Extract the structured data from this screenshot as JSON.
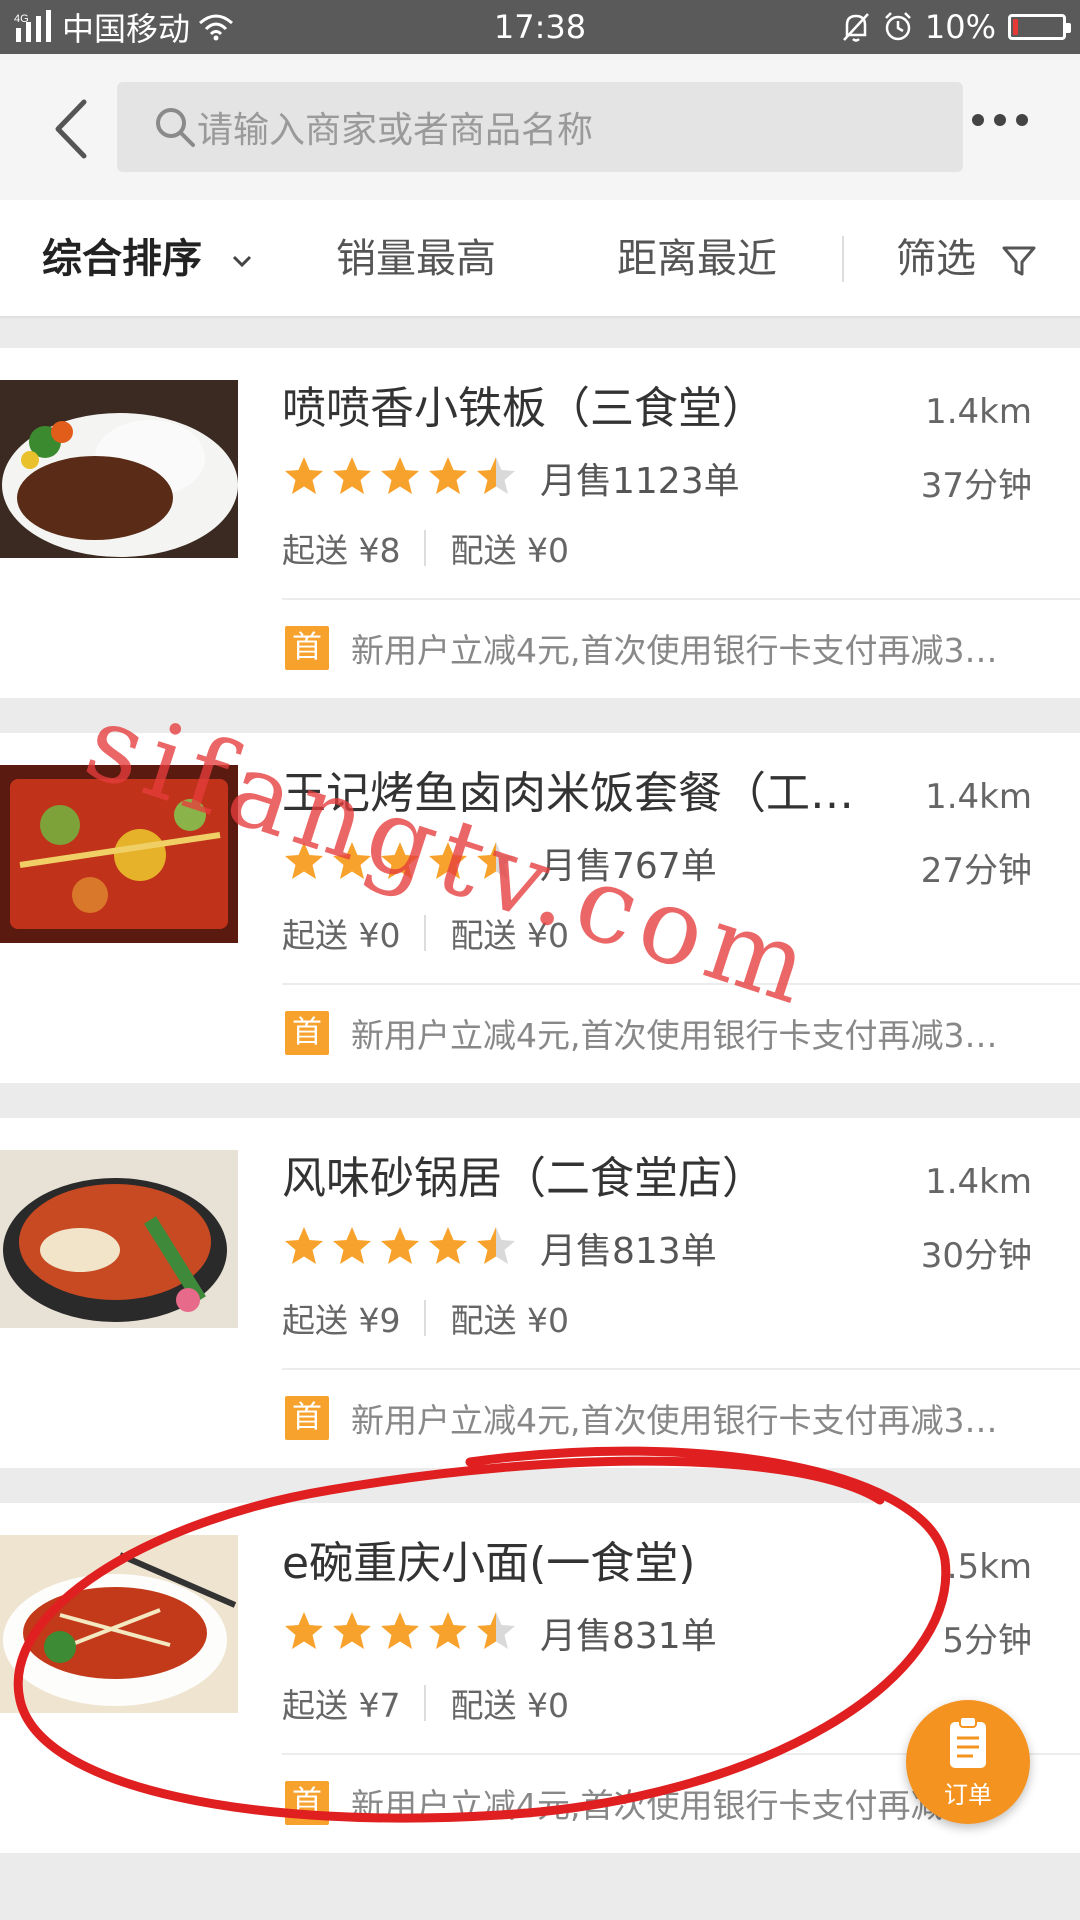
{
  "status_bar": {
    "network": "4G",
    "carrier": "中国移动",
    "time": "17:38",
    "battery": "10%",
    "battery_level": 0.1
  },
  "header": {
    "search_placeholder": "请输入商家或者商品名称"
  },
  "sort_bar": {
    "items": [
      "综合排序",
      "销量最高",
      "距离最近",
      "筛选"
    ]
  },
  "shops": [
    {
      "name": "喷喷香小铁板（三食堂）",
      "distance": "1.4km",
      "time": "37分钟",
      "rating": 4.5,
      "sales": "月售1123单",
      "min_order": "起送 ¥8",
      "delivery_fee": "配送 ¥0",
      "promo_badge": "首",
      "promo_text": "新用户立减4元,首次使用银行卡支付再减3…"
    },
    {
      "name": "王记烤鱼卤肉米饭套餐（工…",
      "distance": "1.4km",
      "time": "27分钟",
      "rating": 4.5,
      "sales": "月售767单",
      "min_order": "起送 ¥0",
      "delivery_fee": "配送 ¥0",
      "promo_badge": "首",
      "promo_text": "新用户立减4元,首次使用银行卡支付再减3…"
    },
    {
      "name": "风味砂锅居（二食堂店）",
      "distance": "1.4km",
      "time": "30分钟",
      "rating": 4.5,
      "sales": "月售813单",
      "min_order": "起送 ¥9",
      "delivery_fee": "配送 ¥0",
      "promo_badge": "首",
      "promo_text": "新用户立减4元,首次使用银行卡支付再减3…"
    },
    {
      "name": "e碗重庆小面(一食堂)",
      "distance": ".5km",
      "time": "5分钟",
      "rating": 4.5,
      "sales": "月售831单",
      "min_order": "起送 ¥7",
      "delivery_fee": "配送 ¥0",
      "promo_badge": "首",
      "promo_text": "新用户立减4元,首次使用银行卡支付再减3…"
    }
  ],
  "order_button": {
    "label": "订单"
  },
  "watermark": "sifangtv.com",
  "colors": {
    "accent_orange": "#f59321",
    "star": "#f7a22c",
    "annotation_red": "#e02020"
  },
  "icons": [
    "signal-icon",
    "wifi-icon",
    "mute-bell-icon",
    "alarm-icon",
    "battery-icon",
    "back-icon",
    "search-icon",
    "more-icon",
    "chevron-down-icon",
    "filter-icon",
    "star-icon",
    "clipboard-icon"
  ]
}
